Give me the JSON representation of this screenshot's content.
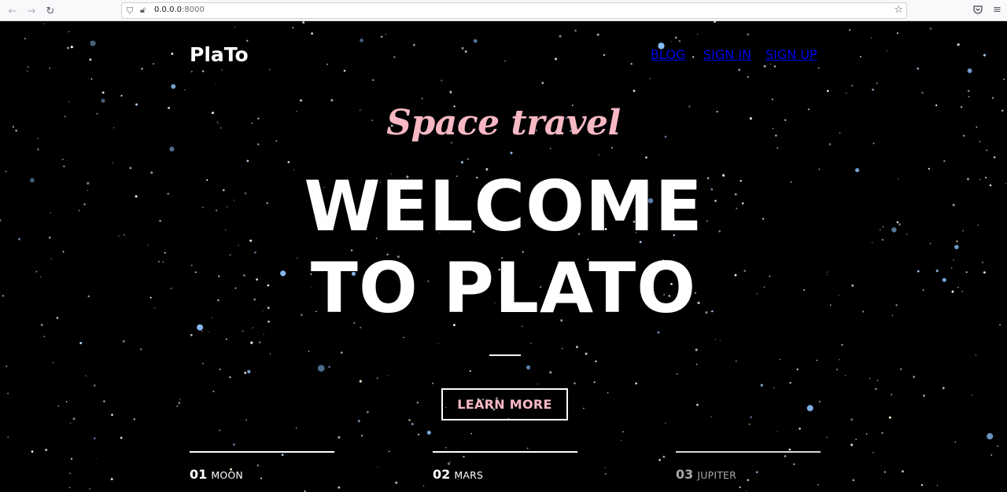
{
  "browser": {
    "url_host": "0.0.0.0",
    "url_port": ":8000"
  },
  "header": {
    "logo": "PlaTo",
    "nav": [
      "BLOG",
      "SIGN IN",
      "SIGN UP"
    ]
  },
  "hero": {
    "subtitle": "Space travel",
    "headline_line1": "WELCOME",
    "headline_line2": "TO PLATO",
    "cta_label": "LEARN MORE"
  },
  "planets": [
    {
      "num": "01",
      "name": "MOON",
      "active": true
    },
    {
      "num": "02",
      "name": "MARS",
      "active": true
    },
    {
      "num": "03",
      "name": "JUPITER",
      "active": false
    }
  ],
  "colors": {
    "background": "#000000",
    "accent_pink": "#f7b8c4",
    "text": "#ffffff"
  }
}
